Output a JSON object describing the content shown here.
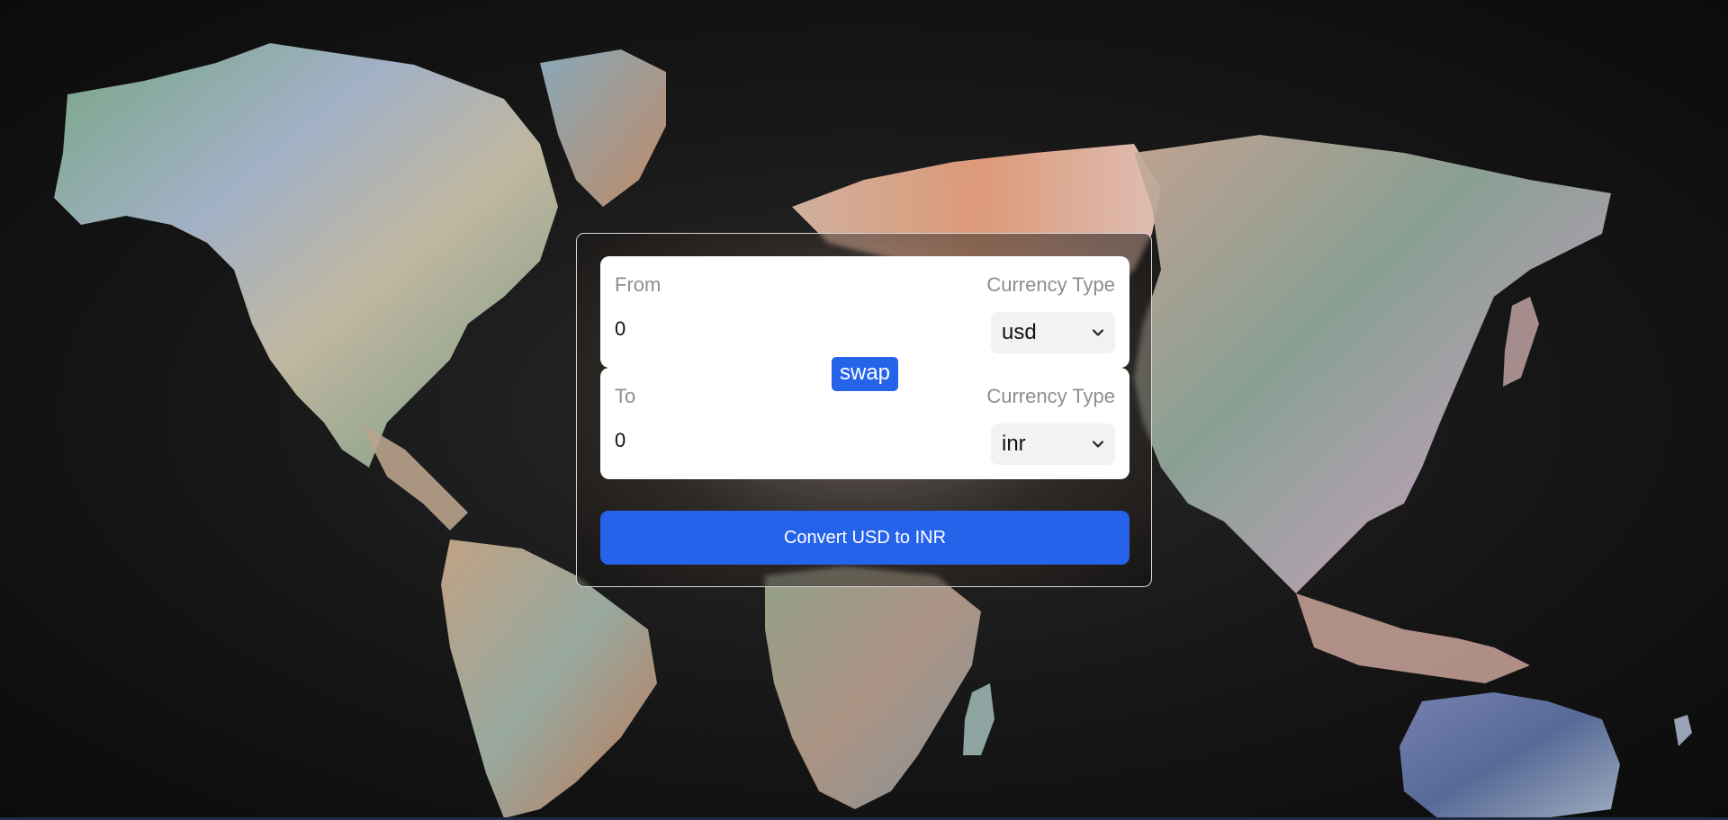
{
  "from": {
    "label": "From",
    "type_label": "Currency Type",
    "amount": "0",
    "currency": "usd"
  },
  "to": {
    "label": "To",
    "type_label": "Currency Type",
    "amount": "0",
    "currency": "inr"
  },
  "swap_label": "swap",
  "convert_label": "Convert USD to INR",
  "colors": {
    "accent": "#2563eb",
    "card_field": "#ffffff",
    "label_gray": "#8e8e8e",
    "background": "#121212"
  },
  "icons": {
    "select_chevron": "chevron-down-icon",
    "background_art": "world-currency-map-image"
  }
}
